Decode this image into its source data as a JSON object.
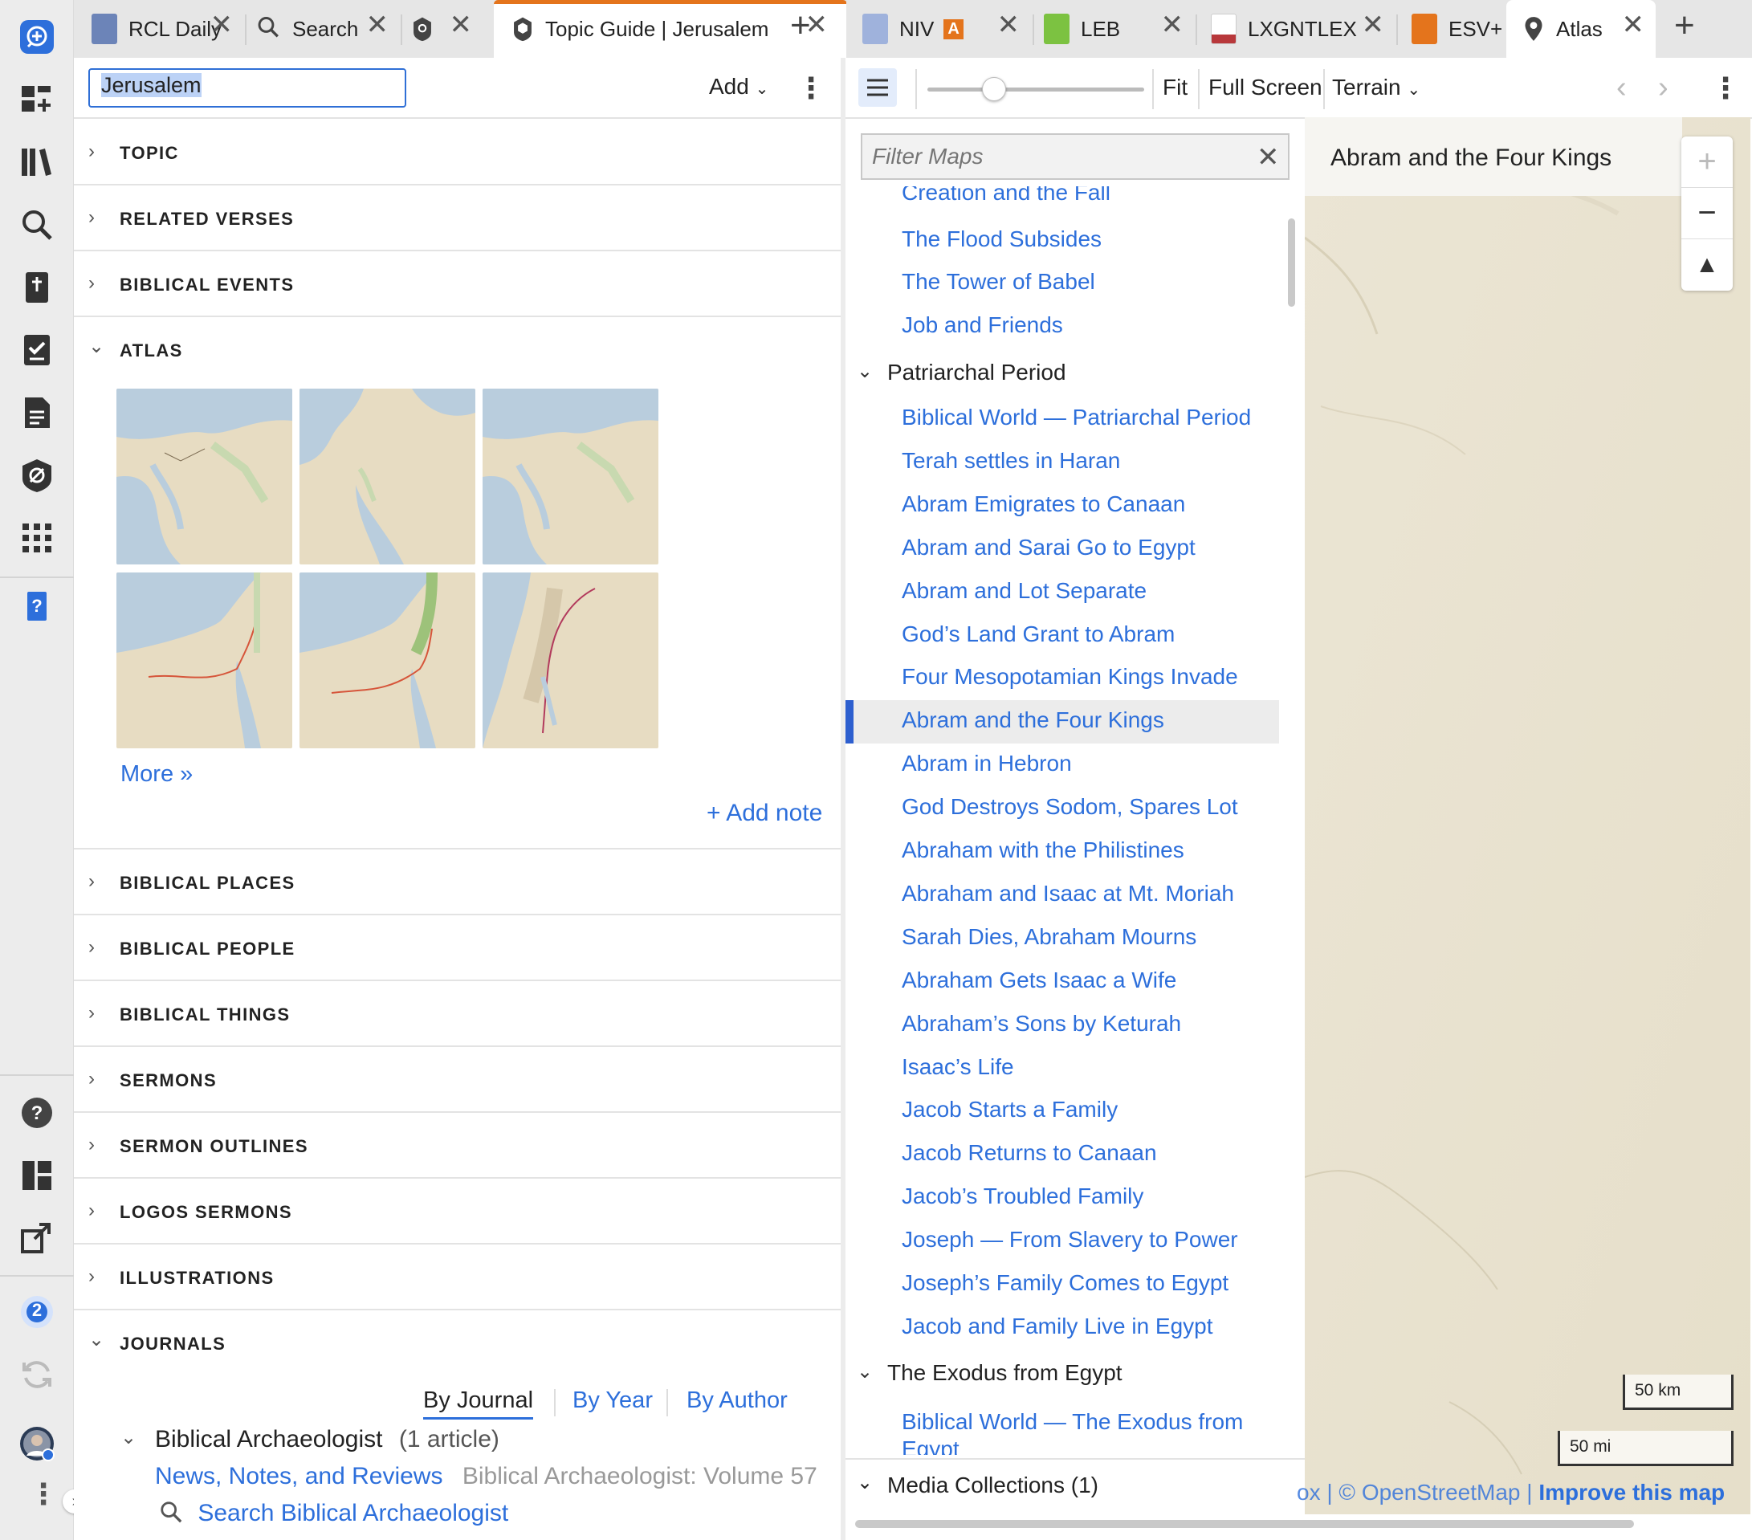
{
  "left_tabs": [
    {
      "label": "RCL Daily",
      "icon": "book-icon"
    },
    {
      "label": "Search",
      "icon": "search-icon"
    },
    {
      "label": "",
      "icon": "factbook-icon"
    },
    {
      "label": "Topic Guide | Jerusalem",
      "icon": "topic-guide-icon"
    }
  ],
  "right_tabs": [
    {
      "label": "NIV",
      "badge": "A",
      "icon": "bible-icon"
    },
    {
      "label": "LEB",
      "icon": "bible-icon"
    },
    {
      "label": "LXGNTLEX",
      "icon": "lexicon-icon"
    },
    {
      "label": "ESV+",
      "icon": "bible-icon"
    },
    {
      "label": "Atlas",
      "icon": "map-pin-icon"
    }
  ],
  "topic_guide": {
    "search_value": "Jerusalem",
    "add_label": "Add",
    "sections_top": [
      "TOPIC",
      "RELATED VERSES",
      "BIBLICAL EVENTS",
      "ATLAS"
    ],
    "more_link": "More »",
    "add_note": "+ Add note",
    "sections_bottom": [
      "BIBLICAL PLACES",
      "BIBLICAL PEOPLE",
      "BIBLICAL THINGS",
      "SERMONS",
      "SERMON OUTLINES",
      "LOGOS SERMONS",
      "ILLUSTRATIONS",
      "JOURNALS"
    ],
    "journals": {
      "tabs": [
        "By Journal",
        "By Year",
        "By Author"
      ],
      "active_tab": "By Journal",
      "journal_name": "Biblical Archaeologist",
      "article_count": "(1 article)",
      "article_title": "News, Notes, and Reviews",
      "article_source": "Biblical Archaeologist: Volume 57",
      "search_link": "Search Biblical Archaeologist"
    }
  },
  "atlas": {
    "toolbar": {
      "fit": "Fit",
      "full_screen": "Full Screen",
      "terrain": "Terrain"
    },
    "filter_placeholder": "Filter Maps",
    "partial_top_item": "Creation and the Fall",
    "items_before_group": [
      "The Flood Subsides",
      "The Tower of Babel",
      "Job and Friends"
    ],
    "group1": "Patriarchal Period",
    "group1_items": [
      "Biblical World — Patriarchal Period",
      "Terah settles in Haran",
      "Abram Emigrates to Canaan",
      "Abram and Sarai Go to Egypt",
      "Abram and Lot Separate",
      "God’s Land Grant to Abram",
      "Four Mesopotamian Kings Invade",
      "Abram and the Four Kings",
      "Abram in Hebron",
      "God Destroys Sodom, Spares Lot",
      "Abraham with the Philistines",
      "Abraham and Isaac at Mt. Moriah",
      "Sarah Dies, Abraham Mourns",
      "Abraham Gets Isaac a Wife",
      "Abraham’s Sons by Keturah",
      "Isaac’s Life",
      "Jacob Starts a Family",
      "Jacob Returns to Canaan",
      "Jacob’s Troubled Family",
      "Joseph — From Slavery to Power",
      "Joseph’s Family Comes to Egypt",
      "Jacob and Family Live in Egypt"
    ],
    "selected_item": "Abram and the Four Kings",
    "group2": "The Exodus from Egypt",
    "group2_items": [
      "Biblical World — The Exodus from Egypt"
    ],
    "media_collections": "Media Collections (1)",
    "map_title": "Abram and the Four Kings",
    "scale_km": "50 km",
    "scale_mi": "50 mi",
    "attribution_prefix": "ox | © OpenStreetMap |",
    "attribution_improve": "Improve this map"
  },
  "rail": {
    "notification_count": "2"
  },
  "colors": {
    "link": "#2d6fdb",
    "accent_tab": "#e4741c",
    "selection": "#2d5fcf"
  }
}
